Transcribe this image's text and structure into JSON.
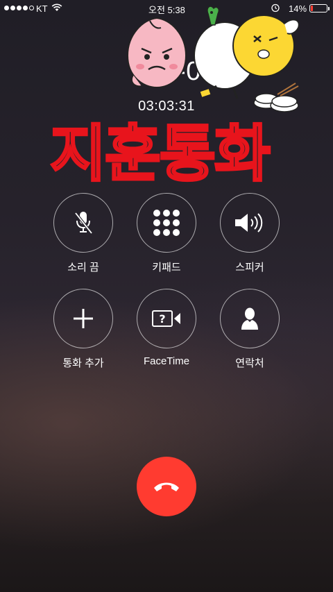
{
  "status_bar": {
    "carrier": "KT",
    "time": "오전 5:38",
    "battery_percent": "14%",
    "battery_level": 0.14,
    "battery_color": "#ff3b30",
    "signal_bars_filled": 4,
    "signal_bars_total": 5
  },
  "call": {
    "caller_text": "010-0",
    "duration": "03:03:31",
    "overlay_text": "지훈통화",
    "overlay_color": "#e8141c"
  },
  "controls": [
    {
      "id": "mute",
      "label": "소리 끔",
      "icon": "mic-muted-icon"
    },
    {
      "id": "keypad",
      "label": "키패드",
      "icon": "keypad-icon"
    },
    {
      "id": "speaker",
      "label": "스피커",
      "icon": "speaker-icon"
    },
    {
      "id": "add-call",
      "label": "통화 추가",
      "icon": "plus-icon"
    },
    {
      "id": "facetime",
      "label": "FaceTime",
      "icon": "facetime-icon"
    },
    {
      "id": "contacts",
      "label": "연락처",
      "icon": "contact-icon"
    }
  ],
  "end_call": {
    "icon": "hang-up-icon",
    "color": "#ff3b30"
  },
  "stickers": [
    "peach-sticker",
    "lion-sticker",
    "dishes-sticker"
  ]
}
